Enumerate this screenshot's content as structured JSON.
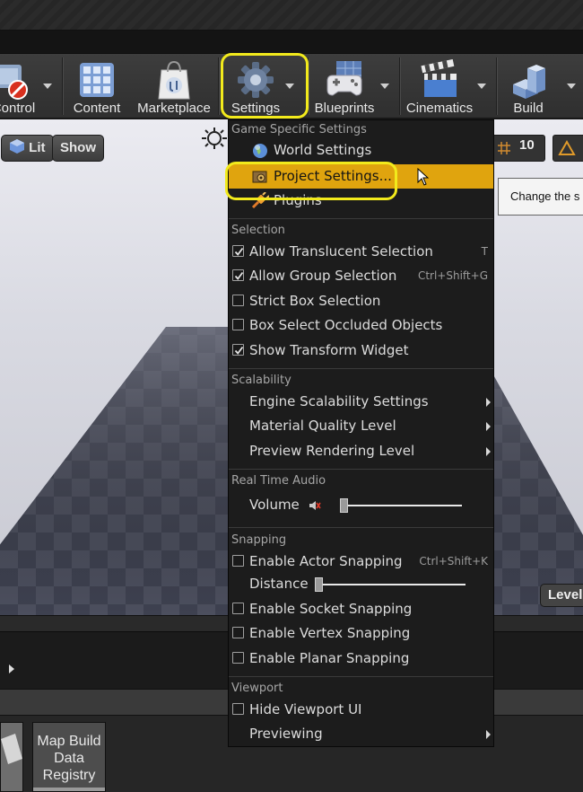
{
  "toolbar": {
    "buttons": [
      {
        "label": "Control",
        "icon": "source-control-icon"
      },
      {
        "label": "Content",
        "icon": "content-browser-icon"
      },
      {
        "label": "Marketplace",
        "icon": "marketplace-icon"
      },
      {
        "label": "Settings",
        "icon": "gear-icon"
      },
      {
        "label": "Blueprints",
        "icon": "blueprints-gamepad-icon"
      },
      {
        "label": "Cinematics",
        "icon": "clapperboard-icon"
      },
      {
        "label": "Build",
        "icon": "build-blocks-icon"
      }
    ]
  },
  "viewport": {
    "lit_label": "Lit",
    "show_label": "Show",
    "grid_snap_value": "10",
    "tooltip_text": "Change the s",
    "level_tag": "Level"
  },
  "menu": {
    "game_section": "Game Specific Settings",
    "world_settings": "World Settings",
    "project_settings": "Project Settings...",
    "plugins": "Plugins",
    "selection_section": "Selection",
    "allow_translucent": "Allow Translucent Selection",
    "allow_translucent_key": "T",
    "allow_group": "Allow Group Selection",
    "allow_group_key": "Ctrl+Shift+G",
    "strict_box": "Strict Box Selection",
    "box_occluded": "Box Select Occluded Objects",
    "show_transform": "Show Transform Widget",
    "scalability_section": "Scalability",
    "engine_scalability": "Engine Scalability Settings",
    "material_quality": "Material Quality Level",
    "preview_rendering": "Preview Rendering Level",
    "audio_section": "Real Time Audio",
    "volume": "Volume",
    "volume_level": 0.0,
    "snapping_section": "Snapping",
    "actor_snapping": "Enable Actor Snapping",
    "actor_snapping_key": "Ctrl+Shift+K",
    "distance": "Distance",
    "distance_level": 0.0,
    "socket_snapping": "Enable Socket Snapping",
    "vertex_snapping": "Enable Vertex Snapping",
    "planar_snapping": "Enable Planar Snapping",
    "viewport_section": "Viewport",
    "hide_viewport_ui": "Hide Viewport UI",
    "previewing": "Previewing",
    "checked": {
      "allow_translucent": true,
      "allow_group": true,
      "strict_box": false,
      "box_occluded": false,
      "show_transform": true,
      "actor_snapping": false,
      "socket_snapping": false,
      "vertex_snapping": false,
      "planar_snapping": false,
      "hide_viewport_ui": false
    }
  },
  "content": {
    "asset_label_line1": "Map Build",
    "asset_label_line2": "Data",
    "asset_label_line3": "Registry"
  },
  "colors": {
    "highlight_ring": "#f2ea1c",
    "menu_hover": "#e0a40e",
    "menu_bg": "#1c1c1c"
  }
}
